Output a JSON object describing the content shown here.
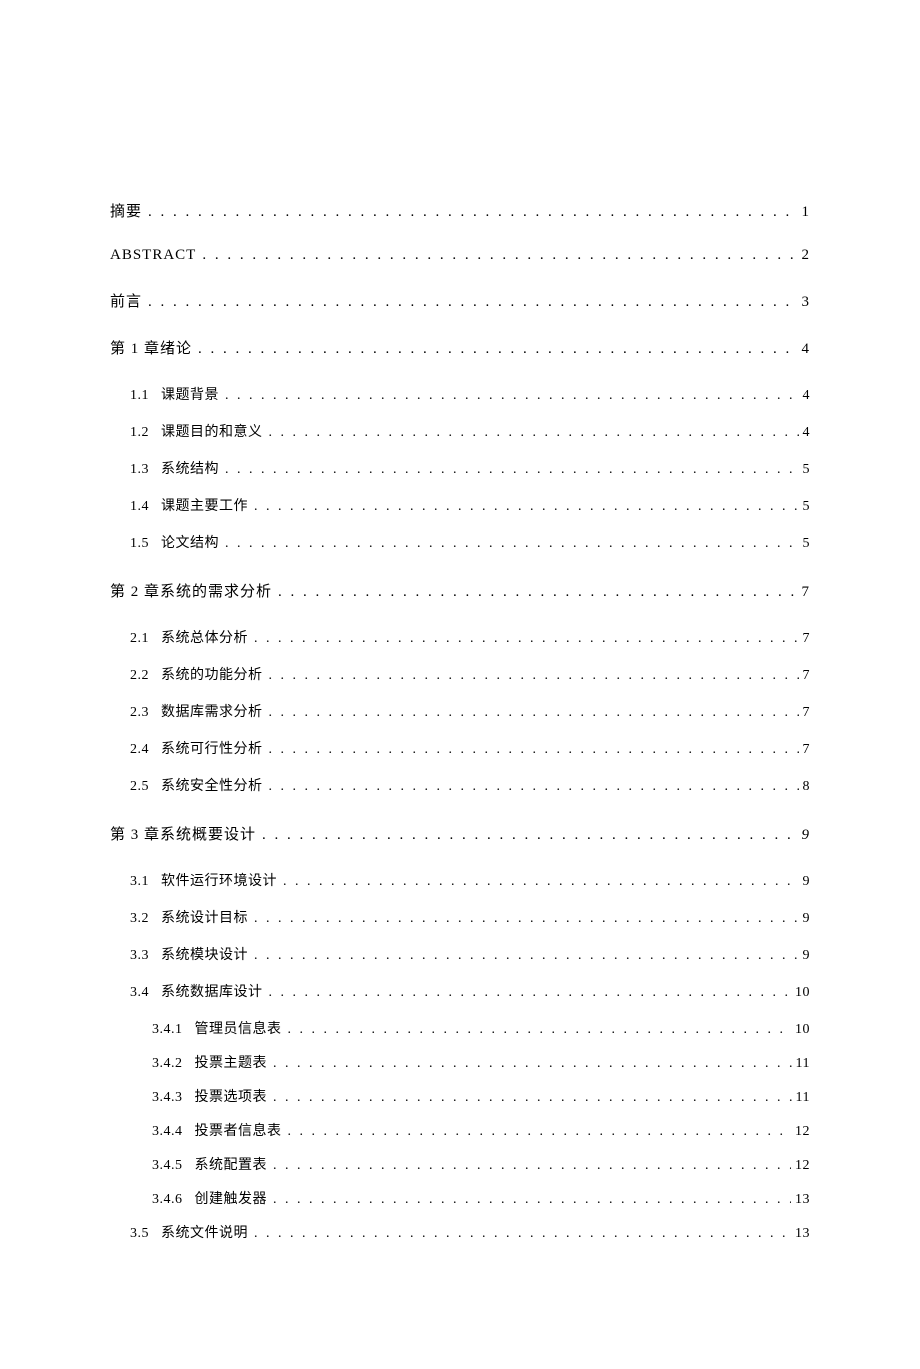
{
  "toc": [
    {
      "level": 0,
      "number": "",
      "title": "摘要",
      "page": "1",
      "gap": false
    },
    {
      "level": 0,
      "number": "",
      "title": "ABSTRACT",
      "page": "2",
      "gap": false
    },
    {
      "level": 0,
      "number": "",
      "title": "前言",
      "page": "3",
      "gap": false
    },
    {
      "level": 0,
      "number": "",
      "title": "第 1 章绪论",
      "page": "4",
      "gap": false
    },
    {
      "level": 1,
      "number": "1.1",
      "title": "课题背景",
      "page": "4",
      "gap": false
    },
    {
      "level": 1,
      "number": "1.2",
      "title": "课题目的和意义",
      "page": "4",
      "gap": false
    },
    {
      "level": 1,
      "number": "1.3",
      "title": "系统结构",
      "page": "5",
      "gap": false
    },
    {
      "level": 1,
      "number": "1.4",
      "title": "课题主要工作",
      "page": "5",
      "gap": false
    },
    {
      "level": 1,
      "number": "1.5",
      "title": "论文结构",
      "page": "5",
      "gap": false
    },
    {
      "level": 0,
      "number": "",
      "title": "第 2 章系统的需求分析",
      "page": "7",
      "gap": true
    },
    {
      "level": 1,
      "number": "2.1",
      "title": "系统总体分析",
      "page": "7",
      "gap": false
    },
    {
      "level": 1,
      "number": "2.2",
      "title": "系统的功能分析",
      "page": "7",
      "gap": false
    },
    {
      "level": 1,
      "number": "2.3",
      "title": "数据库需求分析",
      "page": "7",
      "gap": false
    },
    {
      "level": 1,
      "number": "2.4",
      "title": "系统可行性分析",
      "page": "7",
      "gap": false
    },
    {
      "level": 1,
      "number": "2.5",
      "title": "系统安全性分析",
      "page": "8",
      "gap": false
    },
    {
      "level": 0,
      "number": "",
      "title": "第 3 章系统概要设计",
      "page": "9",
      "gap": true,
      "italicPage": true
    },
    {
      "level": 1,
      "number": "3.1",
      "title": "软件运行环境设计",
      "page": "9",
      "gap": false
    },
    {
      "level": 1,
      "number": "3.2",
      "title": "系统设计目标",
      "page": "9",
      "gap": false
    },
    {
      "level": 1,
      "number": "3.3",
      "title": "系统模块设计",
      "page": "9",
      "gap": false
    },
    {
      "level": 1,
      "number": "3.4",
      "title": "系统数据库设计",
      "page": "10",
      "gap": false
    },
    {
      "level": 2,
      "number": "3.4.1",
      "title": "管理员信息表",
      "page": "10",
      "gap": false
    },
    {
      "level": 2,
      "number": "3.4.2",
      "title": "投票主题表",
      "page": "11",
      "gap": false
    },
    {
      "level": 2,
      "number": "3.4.3",
      "title": "投票选项表",
      "page": "11",
      "gap": false
    },
    {
      "level": 2,
      "number": "3.4.4",
      "title": "投票者信息表",
      "page": "12",
      "gap": false
    },
    {
      "level": 2,
      "number": "3.4.5",
      "title": "系统配置表",
      "page": "12",
      "gap": false
    },
    {
      "level": 2,
      "number": "3.4.6",
      "title": "创建触发器",
      "page": "13",
      "gap": false
    },
    {
      "level": 1,
      "number": "3.5",
      "title": "系统文件说明",
      "page": "13",
      "gap": false
    }
  ]
}
